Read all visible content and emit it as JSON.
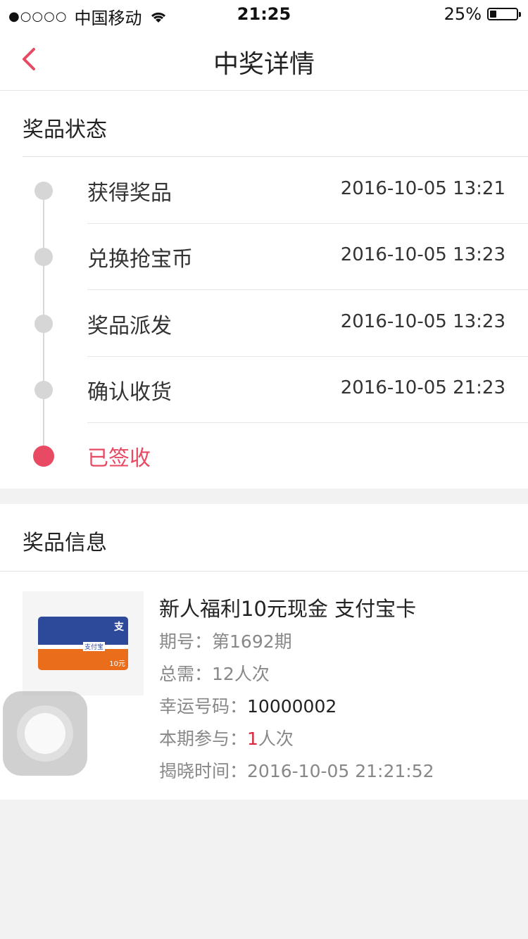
{
  "status_bar": {
    "signal": "●○○○○",
    "carrier": "中国移动",
    "time": "21:25",
    "battery": "25%",
    "battery_level_pct": 25
  },
  "nav": {
    "title": "中奖详情",
    "accent_color": "#e84a63"
  },
  "prize_status": {
    "title": "奖品状态",
    "steps": [
      {
        "label": "获得奖品",
        "time": "2016-10-05 13:21"
      },
      {
        "label": "兑换抢宝币",
        "time": "2016-10-05 13:23"
      },
      {
        "label": "奖品派发",
        "time": "2016-10-05 13:23"
      },
      {
        "label": "确认收货",
        "time": "2016-10-05 21:23"
      },
      {
        "label": "已签收",
        "time": ""
      }
    ]
  },
  "prize_info": {
    "title": "奖品信息",
    "product_title": "新人福利10元现金 支付宝卡",
    "image_card": {
      "logo_char": "支",
      "brand": "支付宝",
      "amount": "10元"
    },
    "rows": {
      "issue_label": "期号：",
      "issue_value": "第1692期",
      "total_label": "总需：",
      "total_value": "12人次",
      "lucky_label": "幸运号码：",
      "lucky_value": "10000002",
      "join_label": "本期参与：",
      "join_count": "1",
      "join_unit": "人次",
      "reveal_label": "揭晓时间：",
      "reveal_value": "2016-10-05 21:21:52"
    }
  }
}
